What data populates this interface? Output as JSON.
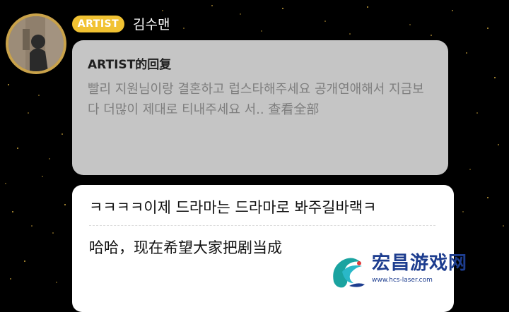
{
  "comment": {
    "badge": "ARTIST",
    "name": "김수맨"
  },
  "quote": {
    "title": "ARTIST的回复",
    "body": "빨리 지원님이랑 결혼하고 럽스타해주세요 공개연애해서 지금보다 더많이 제대로 티내주세요 서..",
    "more_label": "查看全部"
  },
  "reply": {
    "text": "ㅋㅋㅋㅋ이제 드라마는 드라마로 봐주길바랙ㅋ",
    "translation": "哈哈，现在希望大家把剧当成"
  },
  "watermark": {
    "title": "宏昌游戏网",
    "url": "www.hcs-laser.com"
  },
  "colors": {
    "badge": "#f1c232",
    "quote_bg": "#c5c5c5",
    "reply_bg": "#ffffff",
    "watermark": "#1d3d8f"
  }
}
